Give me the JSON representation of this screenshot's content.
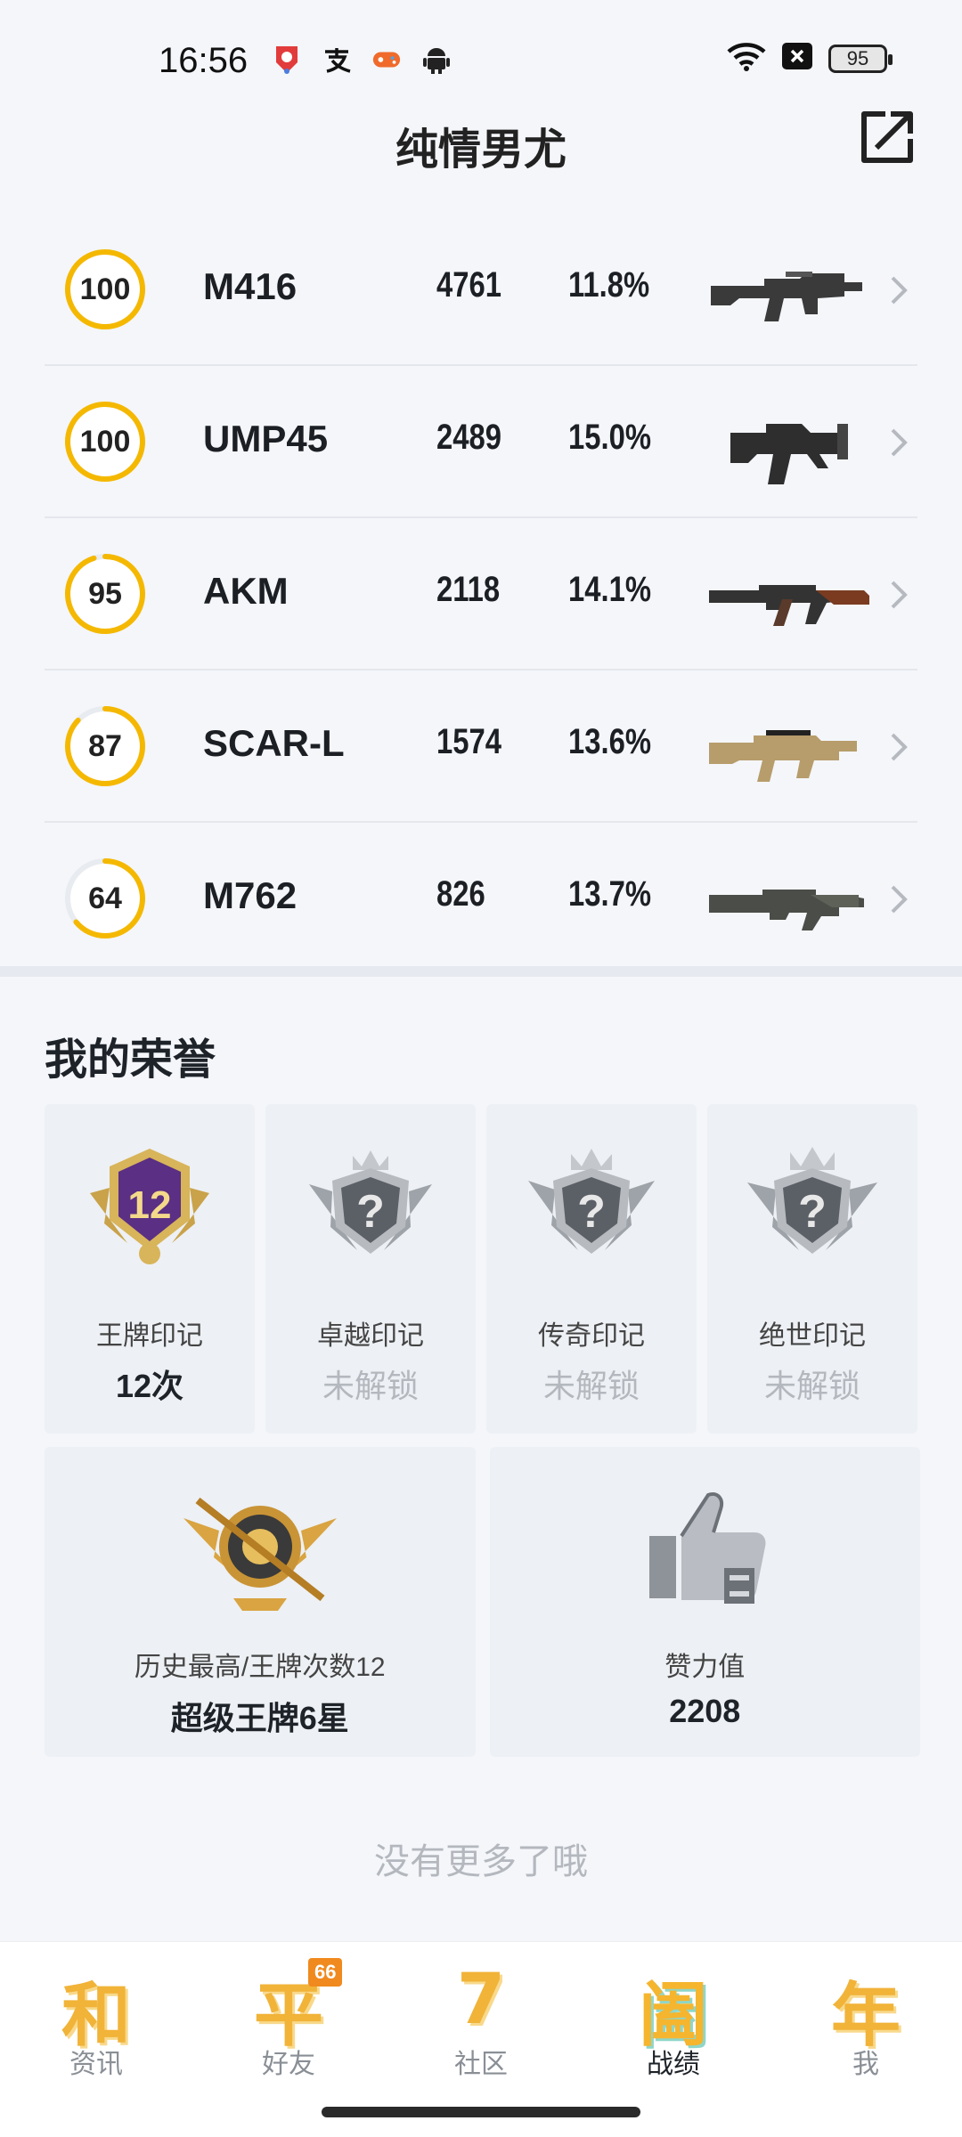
{
  "status_bar": {
    "time": "16:56",
    "left_icons": [
      "app-badge-icon",
      "alipay-icon",
      "game-icon",
      "android-icon"
    ],
    "right_icons": [
      "wifi-icon",
      "close-box-icon"
    ],
    "battery": "95"
  },
  "header": {
    "title": "纯情男尤",
    "share_icon": "share-external-icon"
  },
  "weapons": [
    {
      "score": "100",
      "score_fraction": 1.0,
      "name": "M416",
      "kills": "4761",
      "rate": "11.8%",
      "icon": "m416-rifle-icon"
    },
    {
      "score": "100",
      "score_fraction": 1.0,
      "name": "UMP45",
      "kills": "2489",
      "rate": "15.0%",
      "icon": "ump45-smg-icon"
    },
    {
      "score": "95",
      "score_fraction": 0.95,
      "name": "AKM",
      "kills": "2118",
      "rate": "14.1%",
      "icon": "akm-rifle-icon"
    },
    {
      "score": "87",
      "score_fraction": 0.87,
      "name": "SCAR-L",
      "kills": "1574",
      "rate": "13.6%",
      "icon": "scar-l-rifle-icon"
    },
    {
      "score": "64",
      "score_fraction": 0.64,
      "name": "M762",
      "kills": "826",
      "rate": "13.7%",
      "icon": "m762-rifle-icon"
    }
  ],
  "honors": {
    "title": "我的荣誉",
    "cards": [
      {
        "label": "王牌印记",
        "value": "12次",
        "locked": false,
        "badge_number": "12",
        "icon": "ace-mark-badge-icon"
      },
      {
        "label": "卓越印记",
        "value": "未解锁",
        "locked": true,
        "icon": "locked-badge-icon"
      },
      {
        "label": "传奇印记",
        "value": "未解锁",
        "locked": true,
        "icon": "locked-badge-icon"
      },
      {
        "label": "绝世印记",
        "value": "未解锁",
        "locked": true,
        "icon": "locked-badge-icon"
      }
    ],
    "summary": [
      {
        "label": "历史最高/王牌次数12",
        "value": "超级王牌6星",
        "icon": "ace-rank-emblem-icon"
      },
      {
        "label": "赞力值",
        "value": "2208",
        "icon": "thumbs-up-icon"
      }
    ]
  },
  "footer_text": "没有更多了哦",
  "bottom_nav": [
    {
      "glyph": "和",
      "label": "资讯",
      "active": false
    },
    {
      "glyph": "平",
      "label": "好友",
      "active": false,
      "badge": "66"
    },
    {
      "glyph": "7",
      "label": "社区",
      "active": false
    },
    {
      "glyph": "阖",
      "label": "战绩",
      "active": true
    },
    {
      "glyph": "年",
      "label": "我",
      "active": false
    }
  ],
  "colors": {
    "ring_accent": "#f5b800",
    "ring_track": "#e8ebef",
    "locked_text": "#b4b8be",
    "nav_gold": "#f1b338"
  }
}
